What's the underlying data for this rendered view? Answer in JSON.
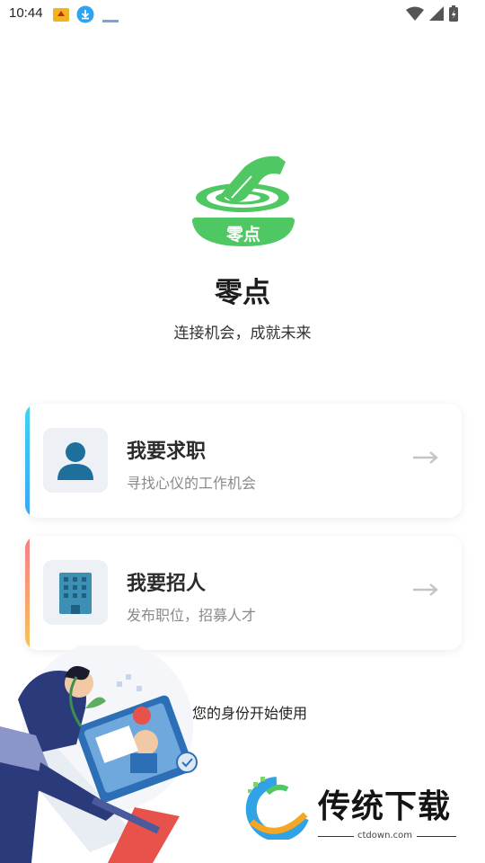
{
  "status_bar": {
    "time": "10:44"
  },
  "app": {
    "logo_text": "零点",
    "title": "零点",
    "subtitle": "连接机会，成就未来",
    "brand_color": "#3fc75a"
  },
  "cards": [
    {
      "title": "我要求职",
      "desc": "寻找心仪的工作机会",
      "icon": "user-icon",
      "accent": "#3fd4f2"
    },
    {
      "title": "我要招人",
      "desc": "发布职位，招募人才",
      "icon": "building-icon",
      "accent": "#f67b8c"
    }
  ],
  "hint": "选择您的身份开始使用",
  "watermark": {
    "text": "传统下载",
    "url": "ctdown.com"
  }
}
